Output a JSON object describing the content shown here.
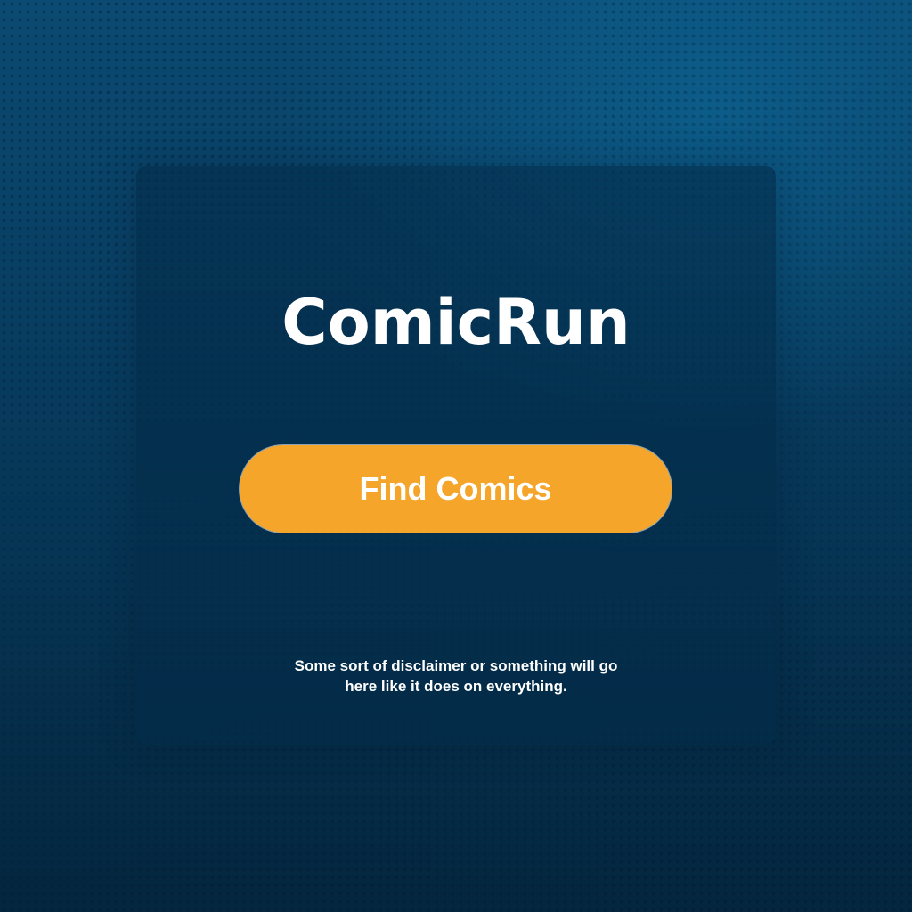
{
  "app": {
    "title": "ComicRun"
  },
  "actions": {
    "find_comics_label": "Find Comics"
  },
  "footer": {
    "disclaimer_line1": "Some sort of disclaimer or something will go",
    "disclaimer_line2": "here like it does on everything."
  },
  "colors": {
    "button_bg": "#f5a62a",
    "text": "#ffffff",
    "background_top": "#0b4a72",
    "background_bottom": "#04263e"
  }
}
